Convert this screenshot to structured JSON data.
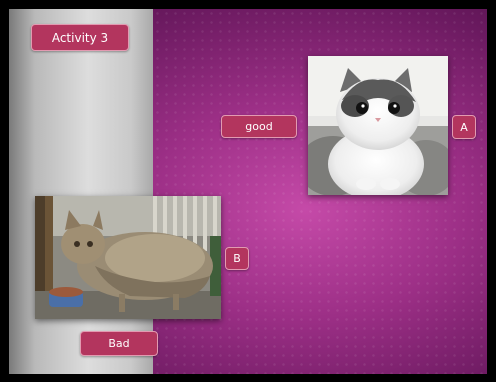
{
  "slide": {
    "title": "Activity 3",
    "labels": {
      "good": "good",
      "bad": "Bad",
      "a": "A",
      "b": "B"
    }
  },
  "images": {
    "cat_a": "white-persian-kitten-photo",
    "cat_b": "scruffy-stray-cat-photo"
  },
  "colors": {
    "label_fill": "#b3355e",
    "label_border": "#e39ab1",
    "background_magenta": "#9c2f86",
    "panel_gray": "#cfcfcf"
  }
}
